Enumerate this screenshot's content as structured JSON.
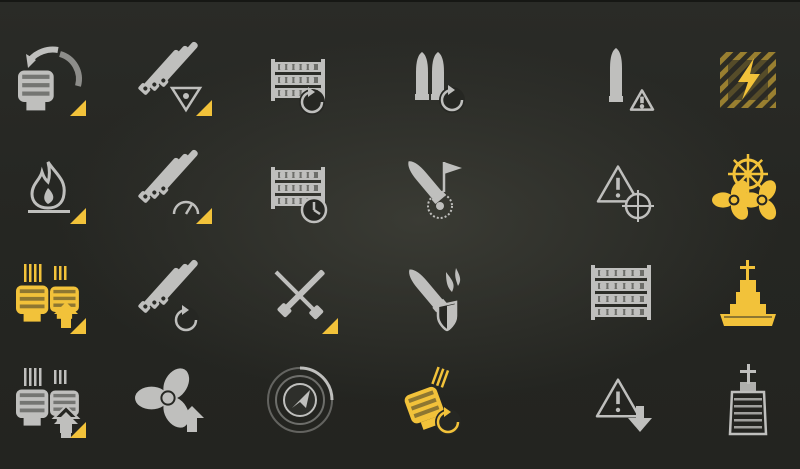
{
  "palette": {
    "gray": "#bfbfbd",
    "gray_dark": "#8d8d8a",
    "gold": "#f2c23a",
    "outline": "#d9d9d6",
    "background": "#262723"
  },
  "grid": {
    "rows": 4,
    "columns": 6,
    "rows_data": [
      {
        "cells": [
          {
            "icon": "turret-rotation-icon",
            "color": "gray",
            "badge": true
          },
          {
            "icon": "gun-barrels-accuracy-icon",
            "color": "gray",
            "badge": true
          },
          {
            "icon": "reload-ammo-rack-icon",
            "color": "gray",
            "badge": false
          },
          {
            "icon": "shells-reload-icon",
            "color": "gray",
            "badge": false
          },
          {
            "icon": "shell-warning-icon",
            "color": "gray",
            "badge": false
          },
          {
            "icon": "hazard-lightning-icon",
            "color": "gold",
            "badge": false
          }
        ]
      },
      {
        "cells": [
          {
            "icon": "fire-icon",
            "color": "gray",
            "badge": true
          },
          {
            "icon": "gun-barrels-speed-icon",
            "color": "gray",
            "badge": true
          },
          {
            "icon": "ammo-rack-timer-icon",
            "color": "gray",
            "badge": false
          },
          {
            "icon": "shell-flag-target-icon",
            "color": "gray",
            "badge": false
          },
          {
            "icon": "warning-crosshair-icon",
            "color": "gray",
            "badge": false
          },
          {
            "icon": "helm-propellers-icon",
            "color": "gold",
            "badge": false
          }
        ]
      },
      {
        "cells": [
          {
            "icon": "turrets-upgrade-icon",
            "color": "gold",
            "badge": true
          },
          {
            "icon": "gun-barrels-reload-icon",
            "color": "gray",
            "badge": false
          },
          {
            "icon": "crossed-guns-icon",
            "color": "gray",
            "badge": true
          },
          {
            "icon": "shell-fire-shield-icon",
            "color": "gray",
            "badge": false
          },
          {
            "icon": "ammo-rack-icon",
            "color": "gray",
            "badge": false
          },
          {
            "icon": "battleship-icon",
            "color": "gold",
            "badge": false
          }
        ]
      },
      {
        "cells": [
          {
            "icon": "turrets-upgrade-gray-icon",
            "color": "gray",
            "badge": true
          },
          {
            "icon": "propeller-upgrade-icon",
            "color": "gray",
            "badge": false
          },
          {
            "icon": "radar-icon",
            "color": "gray",
            "badge": false
          },
          {
            "icon": "turret-rotation-gold-icon",
            "color": "gold",
            "badge": false
          },
          {
            "icon": "warning-down-icon",
            "color": "gray",
            "badge": false
          },
          {
            "icon": "battleship-bow-icon",
            "color": "gray",
            "badge": false
          }
        ]
      }
    ]
  }
}
